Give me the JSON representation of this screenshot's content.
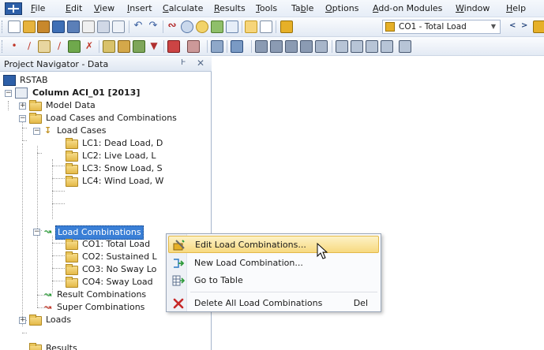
{
  "menubar": {
    "items": [
      {
        "label": "File",
        "ul": "F",
        "rest": "ile"
      },
      {
        "label": "Edit",
        "ul": "E",
        "rest": "dit"
      },
      {
        "label": "View",
        "ul": "V",
        "rest": "iew"
      },
      {
        "label": "Insert",
        "ul": "I",
        "rest": "nsert"
      },
      {
        "label": "Calculate",
        "ul": "C",
        "rest": "alculate"
      },
      {
        "label": "Results",
        "ul": "R",
        "rest": "esults"
      },
      {
        "label": "Tools",
        "ul": "T",
        "rest": "ools"
      },
      {
        "label": "Table",
        "pre": "Ta",
        "ul": "b",
        "rest": "le"
      },
      {
        "label": "Options",
        "ul": "O",
        "rest": "ptions"
      },
      {
        "label": "Add-on Modules",
        "ul": "A",
        "rest": "dd-on Modules"
      },
      {
        "label": "Window",
        "ul": "W",
        "rest": "indow"
      },
      {
        "label": "Help",
        "ul": "H",
        "rest": "elp"
      }
    ]
  },
  "toolbar": {
    "load_case_combo": "CO1 - Total Load"
  },
  "navigator": {
    "title": "Project Navigator - Data",
    "pin": "Ͱ",
    "close": "✕",
    "root": "RSTAB",
    "project": "Column ACI_01 [2013]",
    "model_data": "Model Data",
    "load_cases_combinations": "Load Cases and Combinations",
    "load_cases": "Load Cases",
    "lc": [
      "LC1: Dead Load, D",
      "LC2: Live Load, L",
      "LC3: Snow Load, S",
      "LC4: Wind Load, W"
    ],
    "load_combinations": "Load Combinations",
    "co": [
      "CO1: Total Load",
      "CO2: Sustained L",
      "CO3: No Sway Lo",
      "CO4: Sway Load"
    ],
    "result_combinations": "Result Combinations",
    "super_combinations": "Super Combinations",
    "loads": "Loads",
    "results": "Results"
  },
  "context_menu": {
    "items": [
      {
        "label": "Edit Load Combinations...",
        "shortcut": ""
      },
      {
        "label": "New Load Combination...",
        "shortcut": ""
      },
      {
        "label": "Go to Table",
        "shortcut": ""
      },
      {
        "label": "Delete All Load Combinations",
        "shortcut": "Del"
      }
    ]
  }
}
